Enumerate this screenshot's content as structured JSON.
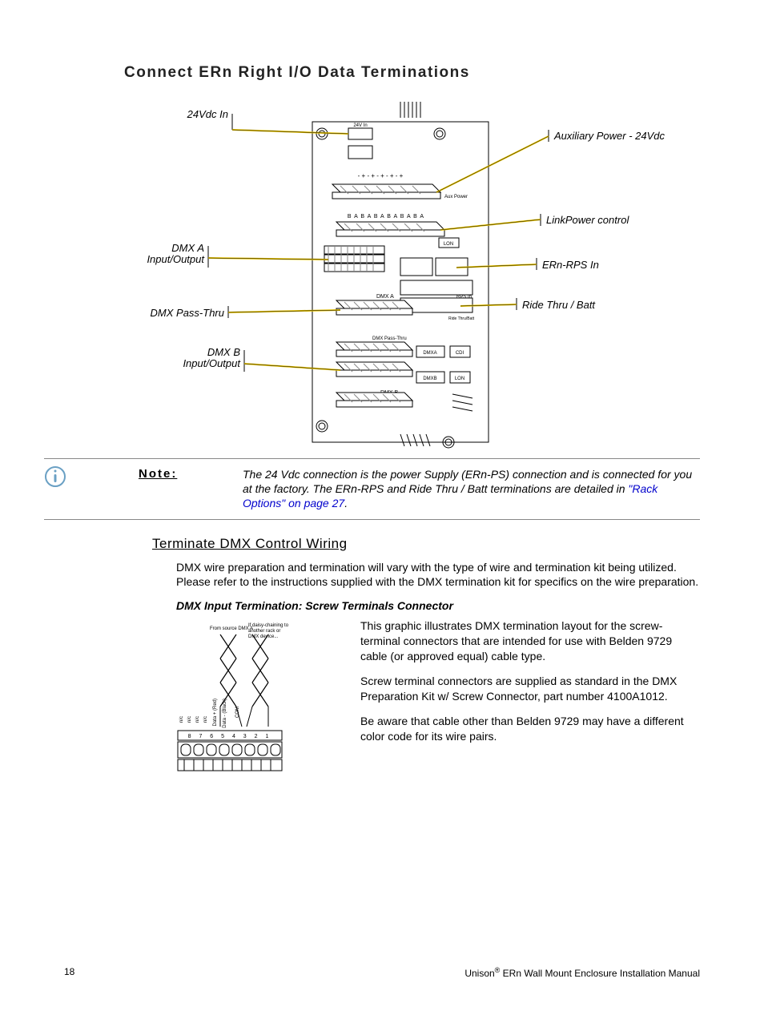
{
  "section_title": "Connect ERn Right I/O Data Terminations",
  "callouts": {
    "left": [
      "24Vdc In",
      "DMX A Input/Output",
      "DMX Pass-Thru",
      "DMX B Input/Output"
    ],
    "right": [
      "Auxiliary Power - 24Vdc",
      "LinkPower control",
      "ERn-RPS In",
      "Ride Thru / Batt"
    ]
  },
  "board_labels": {
    "top_label": "24V In",
    "aux_pwr": "Aux Power",
    "bababa": "B A B A B A B A B A B A",
    "lon_small": "LON",
    "dmx_a": "DMX A",
    "rps_in": "RPS In",
    "ride": "Ride Thru/Batt",
    "pass": "DMX Pass-Thru",
    "dmxa2": "DMXA",
    "cdi": "CDI",
    "dmxb2": "DMXB",
    "lon2": "LON",
    "dmx_b": "DMX B"
  },
  "note": {
    "label": "Note:",
    "text_before_link": "The 24 Vdc connection is the power Supply (ERn-PS) connection and is connected for you at the factory. The ERn-RPS and Ride Thru / Batt terminations are detailed in ",
    "link_text": "\"Rack Options\" on page 27",
    "text_after_link": "."
  },
  "sub_heading": "Terminate DMX Control Wiring",
  "para1": "DMX wire preparation and termination will vary with the type of wire and termination kit being utilized. Please refer to the instructions supplied with the DMX termination kit for specifics on the wire preparation.",
  "dmx_heading": "DMX Input Termination: Screw Terminals Connector",
  "dmx_graphic_labels": {
    "from_source": "From source DMX A",
    "daisy": "If daisy-chaining to another rack or DMX device...",
    "d_plus": "Data + (Red)",
    "d_minus": "Data - (Black)",
    "com": "COM",
    "nc": "n/c",
    "nums": "8  7  6  5  4  3  2  1"
  },
  "dmx_paras": [
    "This graphic illustrates DMX termination layout for the screw-terminal connectors that are intended for use with Belden 9729 cable (or approved equal) cable type.",
    "Screw terminal connectors are supplied as standard in the DMX Preparation Kit w/ Screw Connector, part number 4100A1012.",
    "Be aware that cable other than Belden 9729 may have a different color code for its wire pairs."
  ],
  "footer": {
    "page": "18",
    "title_pre": "Unison",
    "title_post": " ERn Wall Mount Enclosure Installation Manual"
  }
}
